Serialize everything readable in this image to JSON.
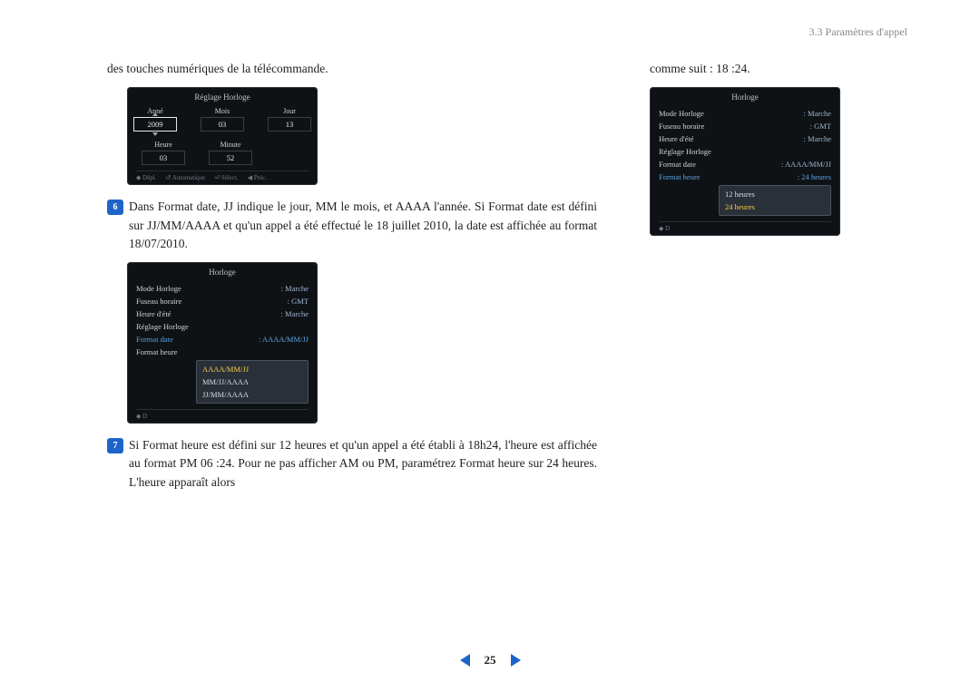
{
  "header": {
    "section": "3.3 Paramètres d'appel"
  },
  "pager": {
    "page": "25"
  },
  "left": {
    "intro": "des touches numériques de la télécommande.",
    "reglage": {
      "title": "Réglage Horloge",
      "labels": {
        "annee": "Anné",
        "mois": "Mois",
        "jour": "Jour",
        "heure": "Heure",
        "minute": "Minute"
      },
      "values": {
        "annee": "2009",
        "mois": "03",
        "jour": "13",
        "heure": "03",
        "minute": "52"
      },
      "hints": {
        "depl": "◆ Dépl.",
        "auto": "↺ Automatique",
        "select": "⏎ Sélect.",
        "prec": "◀ Préc."
      }
    },
    "step6": {
      "num": "6",
      "text": "Dans Format date, JJ indique le jour, MM le mois, et AAAA l'année. Si Format date est défini sur JJ/MM/AAAA et qu'un appel a été effectué le 18 juillet 2010, la date est affichée au format 18/07/2010."
    },
    "horloge1": {
      "title": "Horloge",
      "rows": [
        {
          "k": "Mode Horloge",
          "v": ": Marche"
        },
        {
          "k": "Fuseau horaire",
          "v": ": GMT"
        },
        {
          "k": "Heure d'été",
          "v": ": Marche"
        },
        {
          "k": "Réglage Horloge",
          "v": ""
        },
        {
          "k": "Format date",
          "v": ": AAAA/MM/JJ",
          "hl": true
        },
        {
          "k": "Format heure",
          "v": ""
        }
      ],
      "options": [
        {
          "label": "AAAA/MM/JJ",
          "sel": true
        },
        {
          "label": "MM/JJ/AAAA"
        },
        {
          "label": "JJ/MM/AAAA"
        }
      ],
      "hintD": "◆ D"
    },
    "step7": {
      "num": "7",
      "text": "Si Format heure est défini sur 12 heures et qu'un appel a été établi à 18h24, l'heure est affichée au format PM 06 :24. Pour ne pas afficher AM ou PM, paramétrez Format heure sur 24 heures. L'heure apparaît alors"
    }
  },
  "right": {
    "intro": "comme suit : 18 :24.",
    "horloge2": {
      "title": "Horloge",
      "rows": [
        {
          "k": "Mode Horloge",
          "v": ": Marche"
        },
        {
          "k": "Fuseau horaire",
          "v": ": GMT"
        },
        {
          "k": "Heure d'été",
          "v": ": Marche"
        },
        {
          "k": "Réglage Horloge",
          "v": ""
        },
        {
          "k": "Format date",
          "v": ": AAAA/MM/JJ"
        },
        {
          "k": "Format heure",
          "v": ": 24 heures",
          "hl": true
        }
      ],
      "options": [
        {
          "label": "12 heures"
        },
        {
          "label": "24 heures",
          "sel": true
        }
      ],
      "hintD": "◆ D"
    }
  }
}
